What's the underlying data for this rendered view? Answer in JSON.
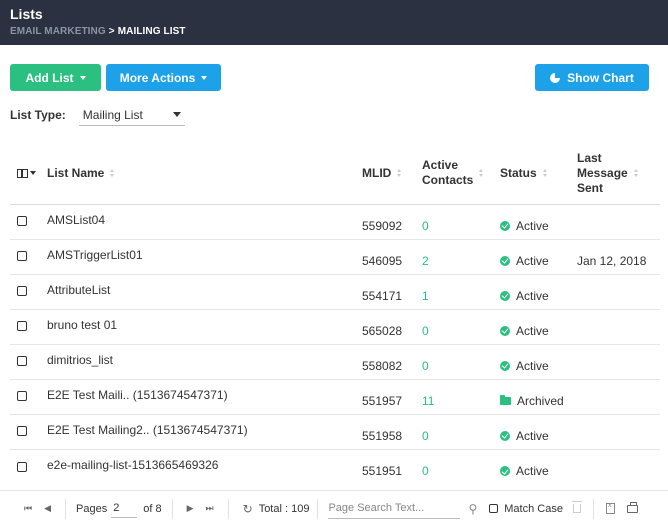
{
  "header": {
    "title": "Lists",
    "crumb_parent": "Email Marketing",
    "crumb_sep": ">",
    "crumb_current": "Mailing List"
  },
  "toolbar": {
    "add_list": "Add List",
    "more_actions": "More Actions",
    "show_chart": "Show Chart"
  },
  "list_type": {
    "label": "List Type:",
    "value": "Mailing List"
  },
  "columns": {
    "name": "List Name",
    "mlid": "MLID",
    "active_1": "Active",
    "active_2": "Contacts",
    "status": "Status",
    "last_1": "Last",
    "last_2": "Message",
    "last_3": "Sent"
  },
  "rows": [
    {
      "name": "AMSList04",
      "mlid": "559092",
      "active": "0",
      "status": "Active",
      "last": ""
    },
    {
      "name": "AMSTriggerList01",
      "mlid": "546095",
      "active": "2",
      "status": "Active",
      "last": "Jan 12, 2018"
    },
    {
      "name": "AttributeList",
      "mlid": "554171",
      "active": "1",
      "status": "Active",
      "last": ""
    },
    {
      "name": "bruno test 01",
      "mlid": "565028",
      "active": "0",
      "status": "Active",
      "last": ""
    },
    {
      "name": "dimitrios_list",
      "mlid": "558082",
      "active": "0",
      "status": "Active",
      "last": ""
    },
    {
      "name": "E2E Test Maili.. (1513674547371)",
      "mlid": "551957",
      "active": "11",
      "status": "Archived",
      "last": ""
    },
    {
      "name": "E2E Test Mailing2.. (1513674547371)",
      "mlid": "551958",
      "active": "0",
      "status": "Active",
      "last": ""
    },
    {
      "name": "e2e-mailing-list-1513665469326",
      "mlid": "551951",
      "active": "0",
      "status": "Active",
      "last": ""
    }
  ],
  "pager": {
    "pages_label": "Pages",
    "page": "2",
    "of_label": "of 8",
    "total": "Total : 109",
    "search_placeholder": "Page Search Text...",
    "match_case": "Match Case"
  },
  "colors": {
    "header_bg": "#2b3140",
    "green": "#2bbf82",
    "blue": "#1da1e8"
  }
}
